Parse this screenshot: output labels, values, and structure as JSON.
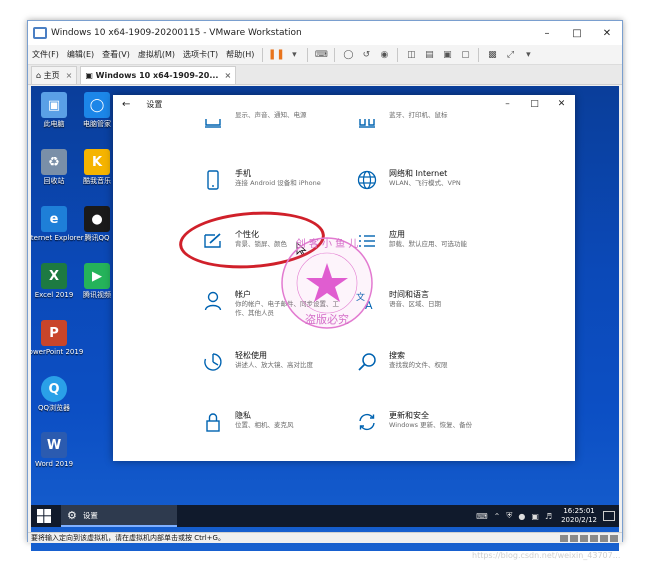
{
  "vm": {
    "title": "Windows 10 x64-1909-20200115 - VMware Workstation",
    "menu": [
      "文件(F)",
      "编辑(E)",
      "查看(V)",
      "虚拟机(M)",
      "选项卡(T)",
      "帮助(H)"
    ],
    "tabs": [
      {
        "label": "主页"
      },
      {
        "label": "Windows 10 x64-1909-20..."
      }
    ],
    "status_text": "要将输入定向到该虚拟机，请在虚拟机内部单击或按 Ctrl+G。"
  },
  "desktop": {
    "icons": [
      {
        "label": "此电脑",
        "icon": "this-pc-icon"
      },
      {
        "label": "电脑管家",
        "icon": "pc-manager-icon"
      },
      {
        "label": "回收站",
        "icon": "recycle-bin-icon"
      },
      {
        "label": "酷我音乐",
        "icon": "kuwo-music-icon"
      },
      {
        "label": "Internet Explorer",
        "icon": "ie-icon"
      },
      {
        "label": "腾讯QQ",
        "icon": "qq-icon"
      },
      {
        "label": "Excel 2019",
        "icon": "excel-icon"
      },
      {
        "label": "腾讯视频",
        "icon": "tencent-video-icon"
      },
      {
        "label": "PowerPoint 2019",
        "icon": "powerpoint-icon"
      },
      {
        "label": "QQ浏览器",
        "icon": "qq-browser-icon"
      },
      {
        "label": "Word 2019",
        "icon": "word-icon"
      }
    ]
  },
  "settings": {
    "title": "设置",
    "categories": [
      {
        "name": "",
        "desc": "显示、声音、通知、电源",
        "icon": "system-icon"
      },
      {
        "name": "",
        "desc": "蓝牙、打印机、鼠标",
        "icon": "devices-icon"
      },
      {
        "name": "手机",
        "desc": "连接 Android 设备和 iPhone",
        "icon": "phone-icon"
      },
      {
        "name": "网络和 Internet",
        "desc": "WLAN、飞行模式、VPN",
        "icon": "globe-icon"
      },
      {
        "name": "个性化",
        "desc": "背景、锁屏、颜色",
        "icon": "personalization-icon"
      },
      {
        "name": "应用",
        "desc": "卸载、默认应用、可选功能",
        "icon": "apps-icon"
      },
      {
        "name": "帐户",
        "desc": "你的帐户、电子邮件、同步设置、工作、其他人员",
        "icon": "account-icon"
      },
      {
        "name": "时间和语言",
        "desc": "语音、区域、日期",
        "icon": "time-language-icon"
      },
      {
        "name": "轻松使用",
        "desc": "讲述人、放大镜、高对比度",
        "icon": "ease-of-access-icon"
      },
      {
        "name": "搜索",
        "desc": "查找我的文件、权限",
        "icon": "search-icon"
      },
      {
        "name": "隐私",
        "desc": "位置、相机、麦克风",
        "icon": "lock-icon"
      },
      {
        "name": "更新和安全",
        "desc": "Windows 更新、恢复、备份",
        "icon": "update-icon"
      }
    ]
  },
  "taskbar": {
    "app_label": "设置",
    "time": "16:25:01",
    "date": "2020/2/12"
  },
  "watermark": {
    "text": "创客小鱼儿 盗版必究"
  },
  "csdn_watermark": "https://blog.csdn.net/weixin_43707..."
}
